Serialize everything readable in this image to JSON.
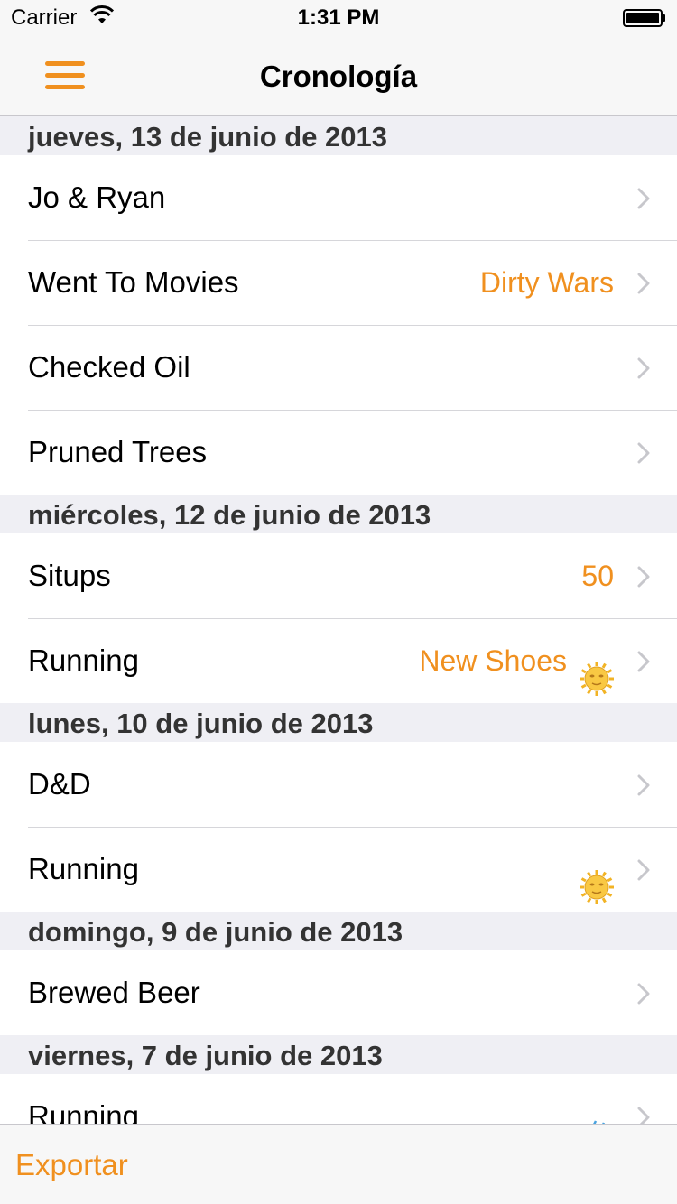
{
  "status_bar": {
    "carrier": "Carrier",
    "time": "1:31 PM"
  },
  "nav": {
    "title": "Cronología",
    "menu_icon": "hamburger-menu-icon"
  },
  "accent_color": "#f0901f",
  "sections": [
    {
      "header": "jueves, 13 de junio de 2013",
      "items": [
        {
          "title": "Jo & Ryan",
          "detail": ""
        },
        {
          "title": "Went To Movies",
          "detail": "Dirty Wars"
        },
        {
          "title": "Checked Oil",
          "detail": ""
        },
        {
          "title": "Pruned Trees",
          "detail": ""
        }
      ]
    },
    {
      "header": "miércoles, 12 de junio de 2013",
      "items": [
        {
          "title": "Situps",
          "detail": "50"
        },
        {
          "title": "Running",
          "detail": "New Shoes",
          "icon": "sun-icon"
        }
      ]
    },
    {
      "header": "lunes, 10 de junio de 2013",
      "items": [
        {
          "title": "D&D",
          "detail": ""
        },
        {
          "title": "Running",
          "detail": "",
          "icon": "sun-icon"
        }
      ]
    },
    {
      "header": "domingo, 9 de junio de 2013",
      "items": [
        {
          "title": "Brewed Beer",
          "detail": ""
        }
      ]
    },
    {
      "header": "viernes, 7 de junio de 2013",
      "items": [
        {
          "title": "Running",
          "detail": "",
          "icon": "rain-cloud-icon"
        }
      ]
    }
  ],
  "toolbar": {
    "export_label": "Exportar"
  }
}
